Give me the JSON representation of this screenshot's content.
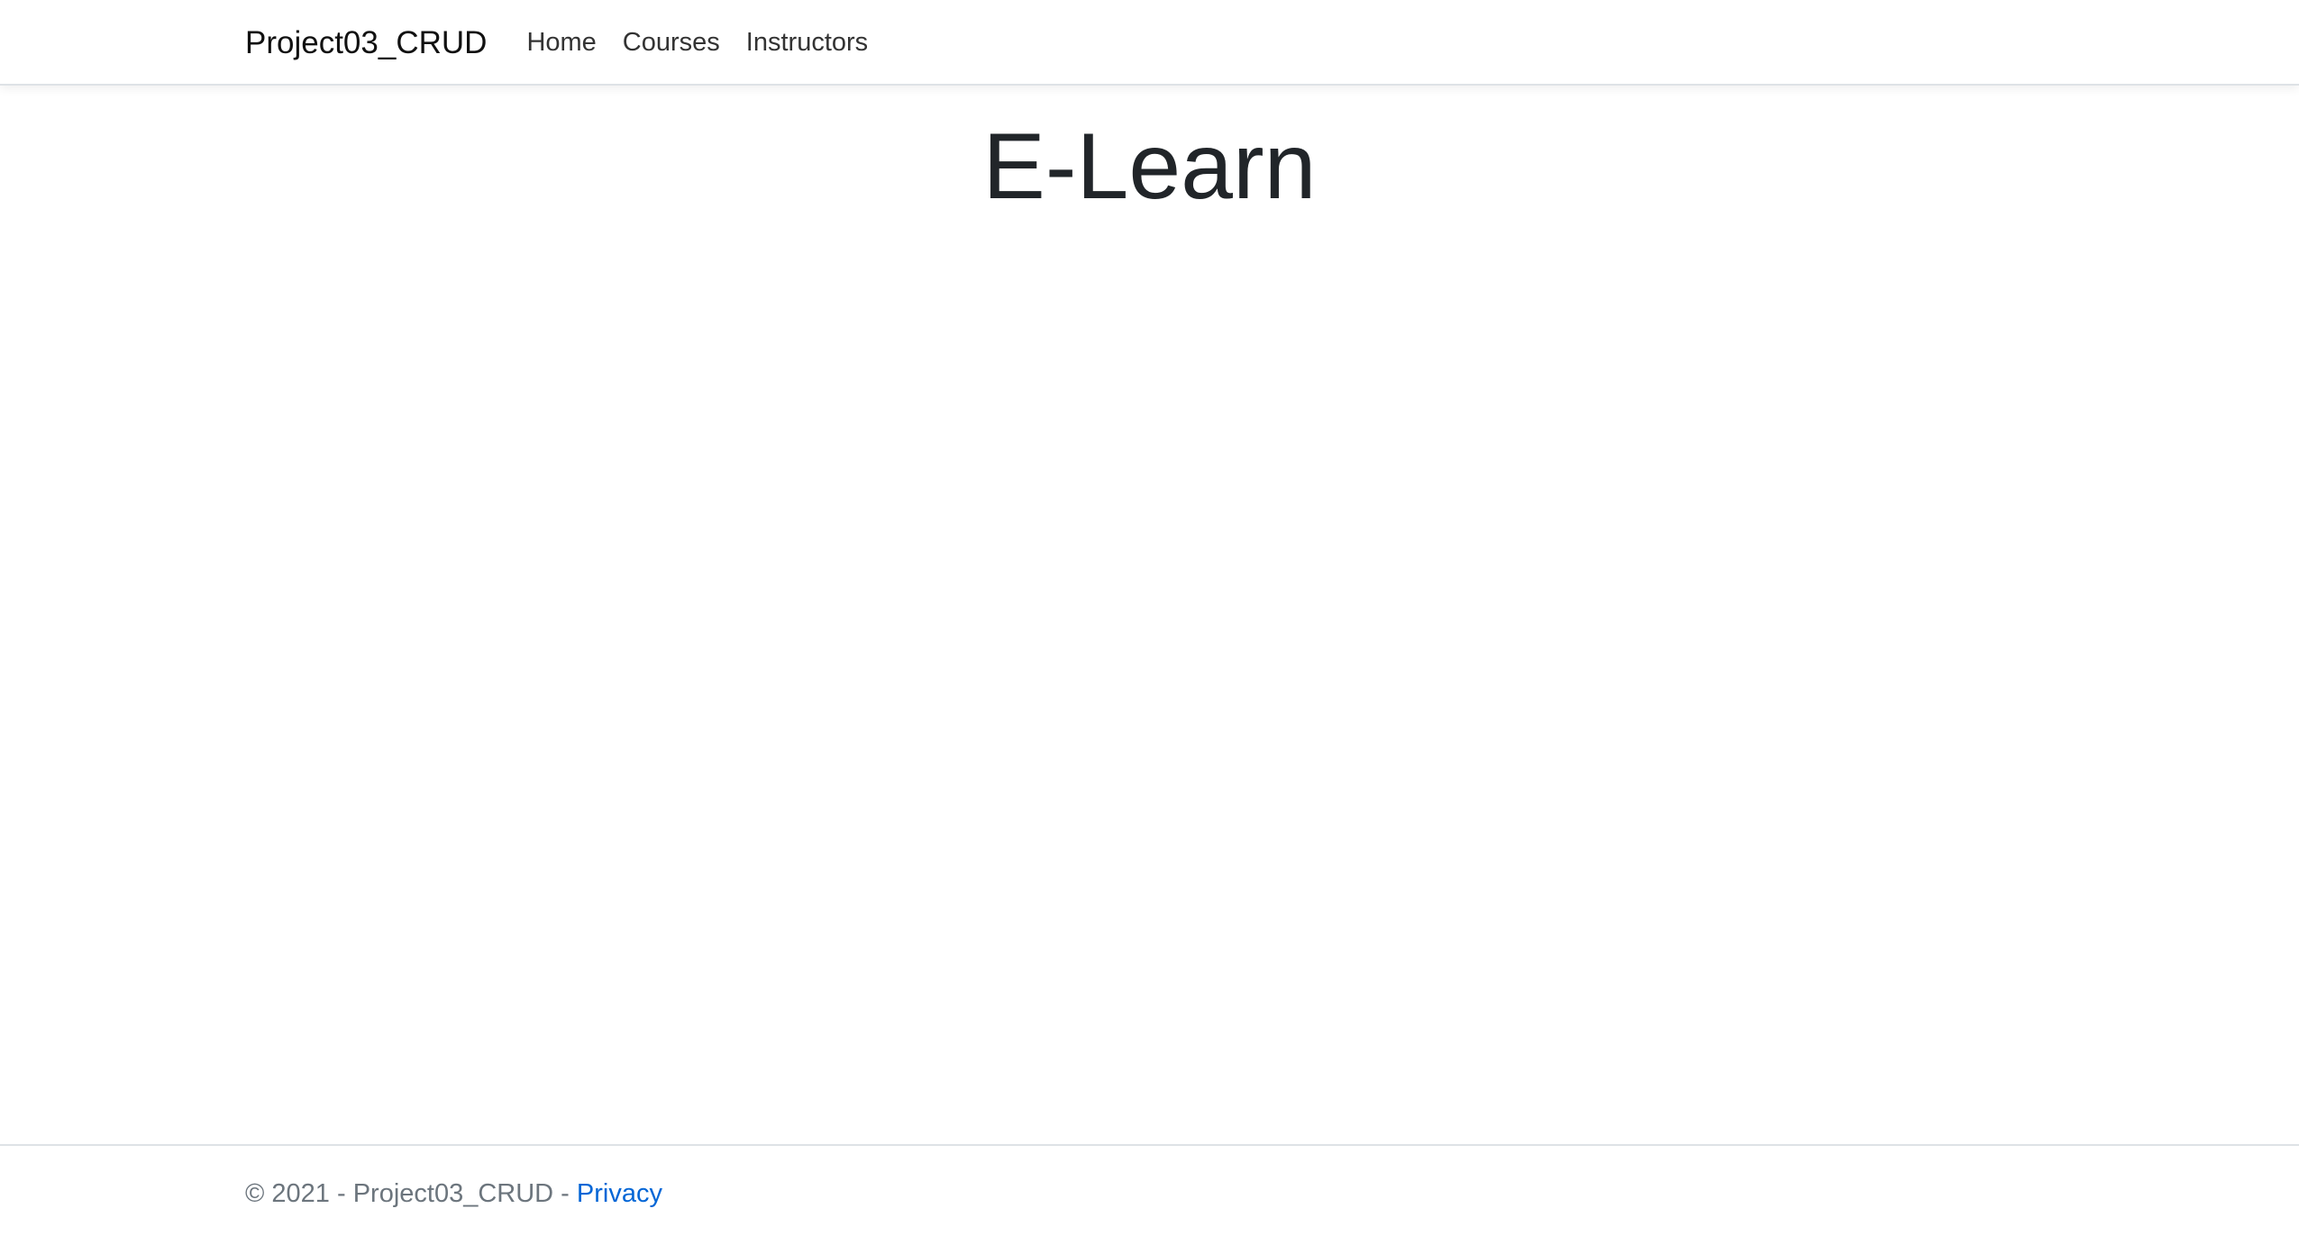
{
  "navbar": {
    "brand": "Project03_CRUD",
    "links": [
      {
        "label": "Home"
      },
      {
        "label": "Courses"
      },
      {
        "label": "Instructors"
      }
    ]
  },
  "main": {
    "title": "E-Learn"
  },
  "footer": {
    "copyright": "© 2021 - Project03_CRUD",
    "separator": " - ",
    "privacy_label": "Privacy",
    "link_color": "#0366d6"
  }
}
